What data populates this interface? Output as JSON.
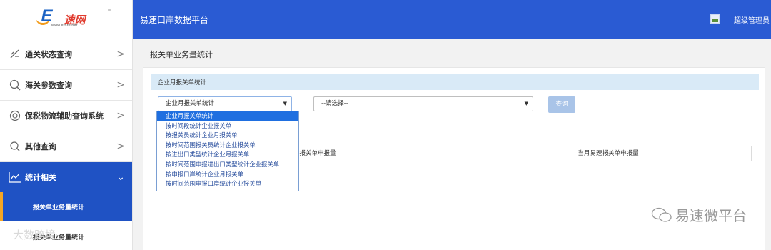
{
  "app": {
    "logo_text": "速网",
    "logo_sub": "www.ethre.net",
    "title": "易速口岸数据平台",
    "user": "超级管理员"
  },
  "sidebar": {
    "items": [
      {
        "label": "通关状态查询",
        "icon": "pen-icon",
        "chevron": ">"
      },
      {
        "label": "海关参数查询",
        "icon": "search-icon",
        "chevron": ">"
      },
      {
        "label": "保税物流辅助查询系统",
        "icon": "target-icon",
        "chevron": ">"
      },
      {
        "label": "其他查询",
        "icon": "search-icon",
        "chevron": ">"
      },
      {
        "label": "统计相关",
        "icon": "chart-icon",
        "chevron": "⌄"
      }
    ],
    "sub_items": [
      {
        "label": "报关单业务量统计"
      },
      {
        "label": "报关单业务量统计"
      }
    ]
  },
  "main": {
    "page_title": "报关单业务量统计",
    "panel_title": "企业月报关单统计",
    "select1_value": "企业月报关单统计",
    "select2_value": "--请选择--",
    "query_button": "查询",
    "columns": [
      "当月报关单申报量",
      "当月易速报关单申报量"
    ],
    "dropdown_options": [
      "企业月报关单统计",
      "按时间段统计企业报关单",
      "按报关员统计企业月报关单",
      "按时间范围报关员统计企业报关单",
      "按进出口类型统计企业月报关单",
      "按时间范围申报进出口类型统计企业报关单",
      "按申报口岸统计企业月报关单",
      "按时间范围申报口岸统计企业报关单"
    ]
  },
  "watermarks": {
    "right": "易速微平台",
    "left": "大数跨境"
  },
  "colors": {
    "accent": "#2a5bd3",
    "active_nav": "#1f52c4",
    "indicator": "#f5a623",
    "panel_head": "#d9eaf7"
  }
}
